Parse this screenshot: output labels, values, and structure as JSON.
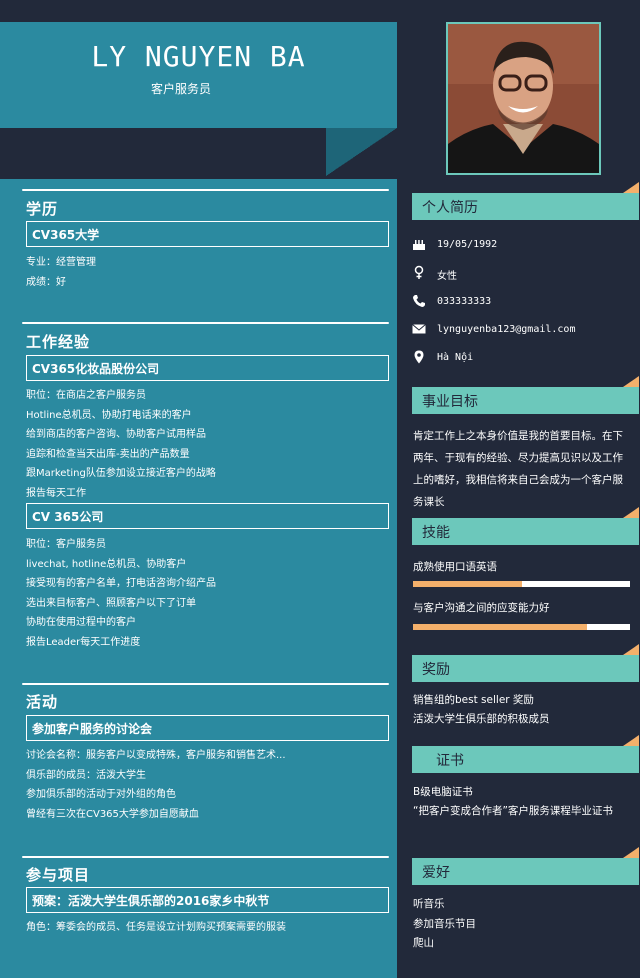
{
  "header": {
    "name": "LY NGUYEN BA",
    "job_title": "客户服务员"
  },
  "education": {
    "title": "学历",
    "school": "CV365大学",
    "lines": [
      "专业：经营管理",
      "成绩：好"
    ]
  },
  "experience": {
    "title": "工作经验",
    "jobs": [
      {
        "company": "CV365化妆品股份公司",
        "lines": [
          "职位：在商店之客户服务员",
          "Hotline总机员、协助打电话来的客户",
          "给到商店的客户咨询、协助客户试用样品",
          "追踪和检查当天出库-卖出的产品数量",
          "跟Marketing队伍参加设立接近客户的战略",
          "报告每天工作"
        ]
      },
      {
        "company": "CV 365公司",
        "lines": [
          "职位：客户服务员",
          "livechat, hotline总机员、协助客户",
          "接受现有的客户名单，打电话咨询介绍产品",
          "选出来目标客户、照顾客户以下了订单",
          "协助在使用过程中的客户",
          "报告Leader每天工作进度"
        ]
      }
    ]
  },
  "activities": {
    "title": "活动",
    "event": "参加客户服务的讨论会",
    "lines": [
      "讨论会名称：服务客户以变成特殊，客户服务和销售艺术...",
      "俱乐部的成员：活泼大学生",
      "参加俱乐部的活动于对外组的角色",
      "曾经有三次在CV365大学参加自愿献血"
    ]
  },
  "projects": {
    "title": "参与项目",
    "project": "预案：活泼大学生俱乐部的2016家乡中秋节",
    "lines": [
      "角色：筹委会的成员、任务是设立计划购买预案需要的服装"
    ]
  },
  "profile": {
    "title": "个人简历",
    "birthday": "19/05/1992",
    "gender": "女性",
    "phone": "033333333",
    "email": "lynguyenba123@gmail.com",
    "address": "Hà Nội",
    "icons": [
      "birthday-cake-icon",
      "female-icon",
      "phone-icon",
      "envelope-icon",
      "map-pin-icon"
    ]
  },
  "objective": {
    "title": "事业目标",
    "text": "肯定工作上之本身价值是我的首要目标。在下两年、于现有的经验、尽力提高见识以及工作上的嗜好，我相信将来自己会成为一个客户服务课长"
  },
  "skills": {
    "title": "技能",
    "items": [
      {
        "name": "成熟使用口语英语",
        "level": 0.5
      },
      {
        "name": "与客户沟通之间的应变能力好",
        "level": 0.8
      }
    ]
  },
  "awards": {
    "title": "奖励",
    "lines": [
      "销售组的best seller 奖励",
      "活泼大学生俱乐部的积极成员"
    ]
  },
  "certificates": {
    "title": "证书",
    "lines": [
      "B级电脑证书",
      "“把客户变成合作者”客户服务课程毕业证书"
    ]
  },
  "hobbies": {
    "title": "爱好",
    "lines": [
      "听音乐",
      "参加音乐节目",
      "爬山"
    ]
  },
  "colors": {
    "teal": "#2b8aa0",
    "mint": "#6cc8bb",
    "navy": "#22293a",
    "orange": "#f4b06b"
  }
}
